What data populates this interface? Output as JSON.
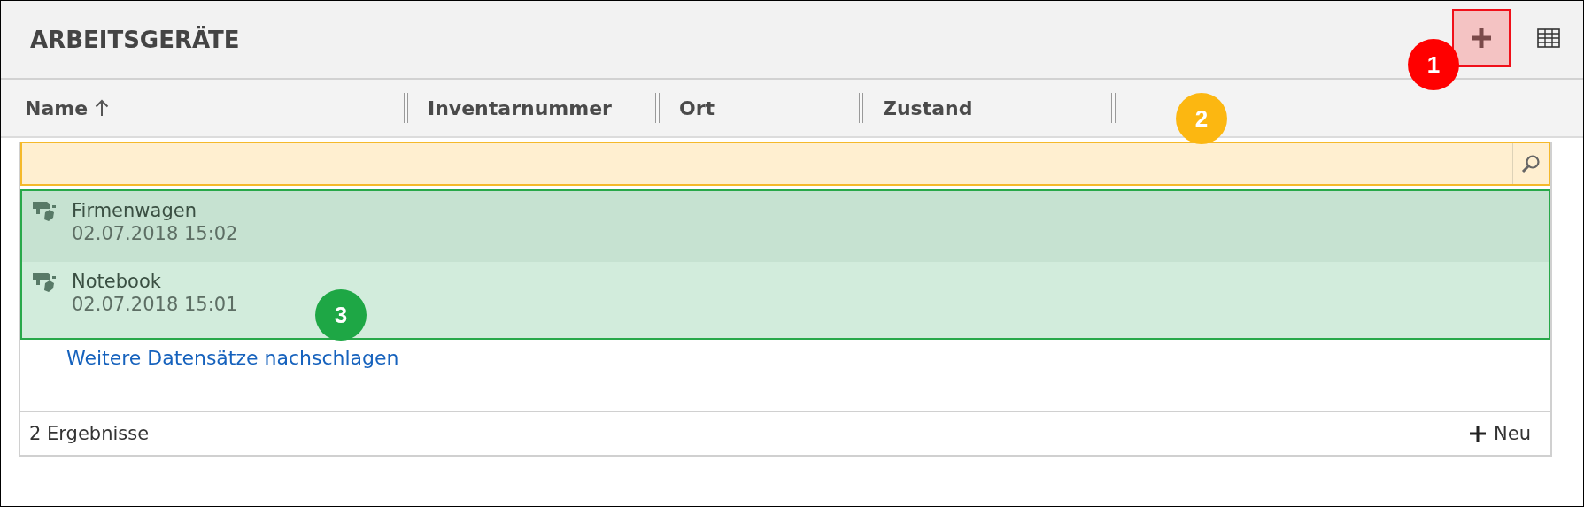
{
  "header": {
    "title": "ARBEITSGERÄTE"
  },
  "columns": [
    {
      "label": "Name",
      "sorted": true
    },
    {
      "label": "Inventarnummer",
      "sorted": false
    },
    {
      "label": "Ort",
      "sorted": false
    },
    {
      "label": "Zustand",
      "sorted": false
    }
  ],
  "rows": [
    {
      "name": "Firmenwagen",
      "date": "02.07.2018 15:02",
      "selected": true
    },
    {
      "name": "Notebook",
      "date": "02.07.2018 15:01",
      "selected": false
    }
  ],
  "more_link": "Weitere Datensätze nachschlagen",
  "footer": {
    "count": "2 Ergebnisse",
    "new_button": "Neu"
  },
  "callouts": [
    {
      "label": "1",
      "color": "#ff0000"
    },
    {
      "label": "2",
      "color": "#fcb711"
    },
    {
      "label": "3",
      "color": "#1ea745"
    }
  ]
}
